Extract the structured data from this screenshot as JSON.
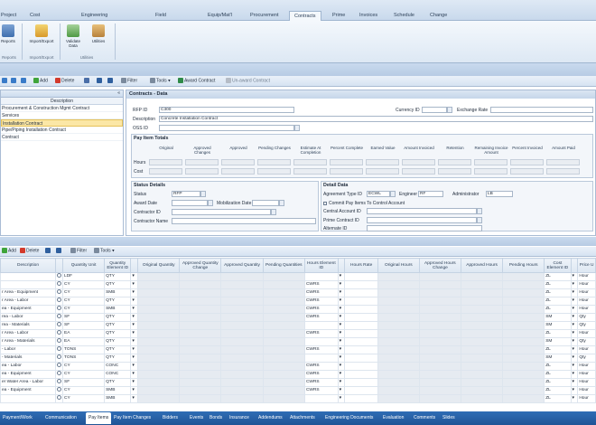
{
  "menu": {
    "tabs": [
      "Project",
      "Cost",
      "Engineering",
      "Field",
      "Equip/Mat'l",
      "Procurement",
      "Contracts",
      "Prime",
      "Invoices",
      "Schedule",
      "Change"
    ],
    "active": "Contracts"
  },
  "ribbon": {
    "reports_label": "Reports",
    "reports_group": "Reports",
    "import_export_label": "Import/Export",
    "import_export_group": "Import/Export",
    "validate_label": "Validate Data",
    "utilities_label": "Utilities",
    "utilities_group": "Utilities"
  },
  "toolbar": {
    "add": "Add",
    "delete": "Delete",
    "filter": "Filter",
    "tools": "Tools",
    "award_contract": "Award Contract",
    "unaward_contract": "Un-award Contract"
  },
  "left_panel": {
    "column_header": "Description",
    "rows": [
      "Procurement & Construction Mgmt Contract",
      "Services",
      "Installation Contract",
      "Pipe/Piping Installation Contract",
      "Contract"
    ],
    "selected_index": 2
  },
  "detail": {
    "title": "Contracts - Data",
    "rfp_id_label": "RFP ID",
    "rfp_id_value": "C300",
    "currency_id_label": "Currency ID",
    "exchange_rate_label": "Exchange Rate",
    "description_label": "Description",
    "description_value": "Concrete Installation Contract",
    "oss_id_label": "OSS ID",
    "pay_item_totals_title": "Pay Item Totals",
    "totals_columns": [
      "Original",
      "Approved Changes",
      "Approved",
      "Pending Changes",
      "Estimate At Completion",
      "Percent Complete",
      "Earned Value",
      "Amount Invoiced",
      "Retention",
      "Remaining Invoice Amount",
      "Percent Invoiced",
      "Amount Paid"
    ],
    "totals_rows": [
      "Hours",
      "Cost"
    ],
    "status_details_title": "Status Details",
    "status_label": "Status",
    "status_value": "RFP",
    "award_date_label": "Award Date",
    "mobilization_date_label": "Mobilization Date",
    "contractor_id_label": "Contractor ID",
    "contractor_name_label": "Contractor Name",
    "detail_data_title": "Detail Data",
    "agreement_type_label": "Agreement Type ID",
    "agreement_type_value": "ECWL",
    "engineer_label": "Engineer",
    "engineer_value": "RF",
    "administrator_label": "Administrator",
    "administrator_value": "LB",
    "commit_label": "Commit Pay Items To Control Account",
    "central_account_label": "Central Account ID",
    "prime_contract_label": "Prime Contract ID",
    "alternate_id_label": "Alternate ID"
  },
  "grid": {
    "columns": [
      "Description",
      "",
      "Quantity Unit",
      "Quantity Element ID",
      "",
      "Original Quantity",
      "Approved Quantity Change",
      "Approved Quantity",
      "Pending Quantities",
      "Hours Element ID",
      "",
      "Hours Rate",
      "Original Hours",
      "Approved Hours Change",
      "Approved Hours",
      "Pending Hours",
      "Cost Element ID",
      "",
      "Price U"
    ],
    "rows": [
      {
        "desc": "",
        "unit": "LDF",
        "qe": "QTY",
        "he": "",
        "ce": "ZL",
        "pu": "Hour"
      },
      {
        "desc": "",
        "unit": "CY",
        "qe": "QTY",
        "he": "CWRS",
        "ce": "ZL",
        "pu": "Hour"
      },
      {
        "desc": "r Area - Equipment",
        "unit": "CY",
        "qe": "SMB",
        "he": "CWRS",
        "ce": "ZL",
        "pu": "Hour"
      },
      {
        "desc": "r Area - Labor",
        "unit": "CY",
        "qe": "QTY",
        "he": "CWRS",
        "ce": "ZL",
        "pu": "Hour"
      },
      {
        "desc": "ea - Equipment",
        "unit": "CY",
        "qe": "SMB",
        "he": "CWRS",
        "ce": "ZL",
        "pu": "Hour"
      },
      {
        "desc": "rea - Labor",
        "unit": "SF",
        "qe": "QTY",
        "he": "CWRS",
        "ce": "SM",
        "pu": "Qty"
      },
      {
        "desc": "rea - Materials",
        "unit": "SF",
        "qe": "QTY",
        "he": "",
        "ce": "SM",
        "pu": "Qty"
      },
      {
        "desc": "r Area - Labor",
        "unit": "EA",
        "qe": "QTY",
        "he": "CWRS",
        "ce": "ZL",
        "pu": "Hour"
      },
      {
        "desc": "r Area - Materials",
        "unit": "EA",
        "qe": "QTY",
        "he": "",
        "ce": "SM",
        "pu": "Qty"
      },
      {
        "desc": "- Labor",
        "unit": "TONS",
        "qe": "QTY",
        "he": "CWRS",
        "ce": "ZL",
        "pu": "Hour"
      },
      {
        "desc": "- Materials",
        "unit": "TONS",
        "qe": "QTY",
        "he": "",
        "ce": "SM",
        "pu": "Qty"
      },
      {
        "desc": "ea - Labor",
        "unit": "CY",
        "qe": "CONC",
        "he": "CWRS",
        "ce": "ZL",
        "pu": "Hour"
      },
      {
        "desc": "ea - Equipment",
        "unit": "CY",
        "qe": "CONC",
        "he": "CWRS",
        "ce": "ZL",
        "pu": "Hour"
      },
      {
        "desc": "er Water Area - Labor",
        "unit": "SF",
        "qe": "QTY",
        "he": "CWRS",
        "ce": "ZL",
        "pu": "Hour"
      },
      {
        "desc": "ea - Equipment",
        "unit": "CY",
        "qe": "SMB",
        "he": "CWRS",
        "ce": "ZL",
        "pu": "Hour"
      },
      {
        "desc": "",
        "unit": "CY",
        "qe": "SMB",
        "he": "",
        "ce": "ZL",
        "pu": "Hour"
      }
    ]
  },
  "bottom_tabs": {
    "tabs": [
      "Payment/Work",
      "Communication",
      "Pay Items",
      "Pay Item Changes",
      "Bidders",
      "Events",
      "Bonds",
      "Insurance",
      "Addendums",
      "Attachments",
      "Engineering Documents",
      "Evaluation",
      "Comments",
      "Slides"
    ],
    "active": "Pay Items"
  },
  "colors": {
    "accent": "#1f5496",
    "selected_row": "#fbe7a6"
  }
}
